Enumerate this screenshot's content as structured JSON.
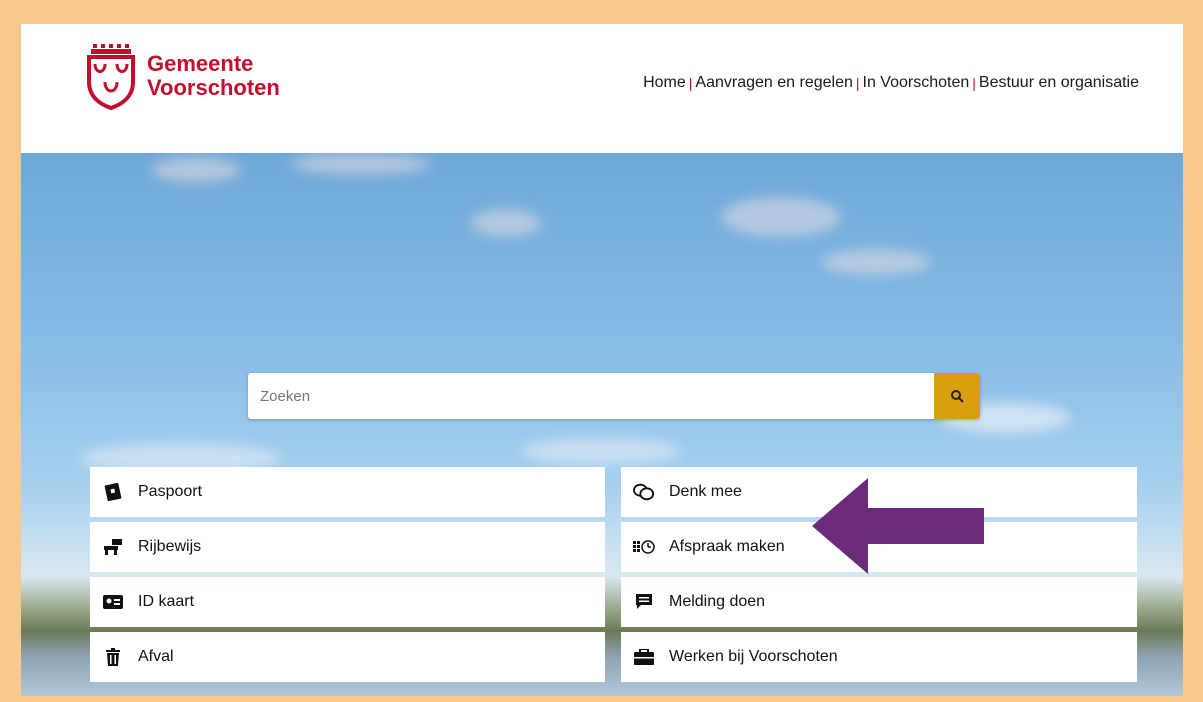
{
  "header": {
    "logo_text_line1": "Gemeente",
    "logo_text_line2": "Voorschoten",
    "nav": [
      "Home",
      "Aanvragen en regelen",
      "In Voorschoten",
      "Bestuur en organisatie"
    ]
  },
  "search": {
    "placeholder": "Zoeken"
  },
  "tiles_left": [
    {
      "label": "Paspoort",
      "icon": "passport-icon"
    },
    {
      "label": "Rijbewijs",
      "icon": "drivers-license-icon"
    },
    {
      "label": "ID kaart",
      "icon": "id-card-icon"
    },
    {
      "label": "Afval",
      "icon": "trash-icon"
    }
  ],
  "tiles_right": [
    {
      "label": "Denk mee",
      "icon": "chat-bubbles-icon"
    },
    {
      "label": "Afspraak maken",
      "icon": "appointment-calendar-icon"
    },
    {
      "label": "Melding doen",
      "icon": "message-icon"
    },
    {
      "label": "Werken bij Voorschoten",
      "icon": "briefcase-icon"
    }
  ],
  "colors": {
    "brand": "#c0102e",
    "accent": "#d99e0e",
    "frame": "#f7c98f",
    "annotation_arrow": "#6b2a7a"
  }
}
